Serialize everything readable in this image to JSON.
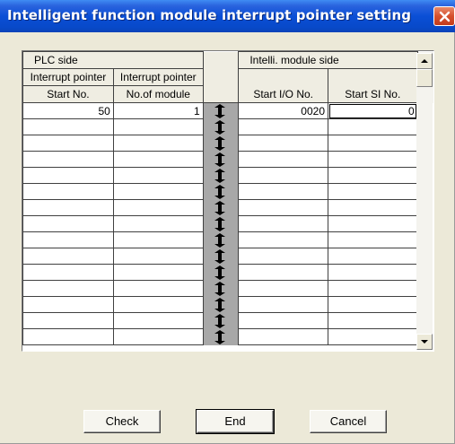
{
  "window": {
    "title": "Intelligent function module interrupt pointer setting"
  },
  "table": {
    "group_headers": {
      "plc_side": "PLC side",
      "intelli_side": "Intelli. module side"
    },
    "columns": {
      "interrupt_start_line1": "Interrupt pointer",
      "interrupt_start_line2": "Start No.",
      "interrupt_count_line1": "Interrupt pointer",
      "interrupt_count_line2": "No.of module",
      "start_io": "Start I/O No.",
      "start_si": "Start SI No."
    },
    "rows": [
      {
        "start_no": "50",
        "count": "1",
        "start_io": "0020",
        "start_si": "0"
      },
      {
        "start_no": "",
        "count": "",
        "start_io": "",
        "start_si": ""
      },
      {
        "start_no": "",
        "count": "",
        "start_io": "",
        "start_si": ""
      },
      {
        "start_no": "",
        "count": "",
        "start_io": "",
        "start_si": ""
      },
      {
        "start_no": "",
        "count": "",
        "start_io": "",
        "start_si": ""
      },
      {
        "start_no": "",
        "count": "",
        "start_io": "",
        "start_si": ""
      },
      {
        "start_no": "",
        "count": "",
        "start_io": "",
        "start_si": ""
      },
      {
        "start_no": "",
        "count": "",
        "start_io": "",
        "start_si": ""
      },
      {
        "start_no": "",
        "count": "",
        "start_io": "",
        "start_si": ""
      },
      {
        "start_no": "",
        "count": "",
        "start_io": "",
        "start_si": ""
      },
      {
        "start_no": "",
        "count": "",
        "start_io": "",
        "start_si": ""
      },
      {
        "start_no": "",
        "count": "",
        "start_io": "",
        "start_si": ""
      },
      {
        "start_no": "",
        "count": "",
        "start_io": "",
        "start_si": ""
      },
      {
        "start_no": "",
        "count": "",
        "start_io": "",
        "start_si": ""
      },
      {
        "start_no": "",
        "count": "",
        "start_io": "",
        "start_si": ""
      }
    ]
  },
  "buttons": {
    "check": "Check",
    "end": "End",
    "cancel": "Cancel"
  },
  "icons": {
    "close": "close-icon",
    "arrow": "double-arrow-icon",
    "scroll_up": "scroll-up-icon",
    "scroll_down": "scroll-down-icon"
  },
  "colors": {
    "titlebar": "#0a4fd6",
    "close_button": "#d5502e",
    "dialog_background": "#ece9d8",
    "separator_column": "#a8a8a8"
  }
}
